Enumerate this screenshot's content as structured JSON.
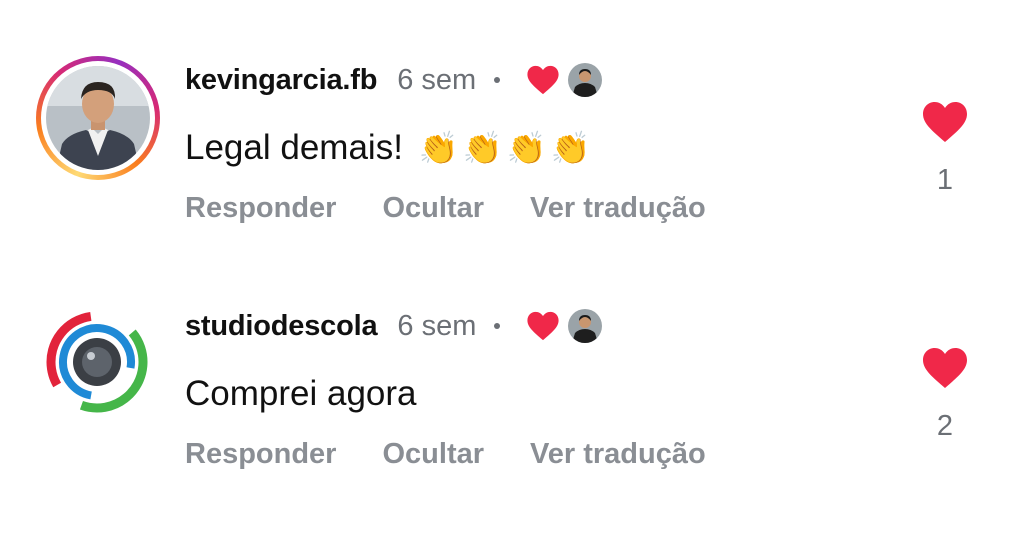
{
  "comments": [
    {
      "username": "kevingarcia.fb",
      "time": "6 sem",
      "text": "Legal demais!",
      "emoji": [
        "👏",
        "👏",
        "👏",
        "👏"
      ],
      "actions": {
        "reply": "Responder",
        "hide": "Ocultar",
        "translate": "Ver tradução"
      },
      "like_count": "1"
    },
    {
      "username": "studiodescola",
      "time": "6 sem",
      "text": "Comprei agora",
      "emoji": [],
      "actions": {
        "reply": "Responder",
        "hide": "Ocultar",
        "translate": "Ver tradução"
      },
      "like_count": "2"
    }
  ],
  "icons": {
    "like": "heart-icon",
    "creator_like": "heart-icon",
    "separator": "dot"
  },
  "colors": {
    "heart": "#f02849",
    "muted_text": "#8a8e94",
    "story_ring": [
      "#feda75",
      "#fa7e1e",
      "#d62976",
      "#962fbf"
    ],
    "logo": [
      "#e2233b",
      "#1f8ad6",
      "#45b649"
    ]
  }
}
